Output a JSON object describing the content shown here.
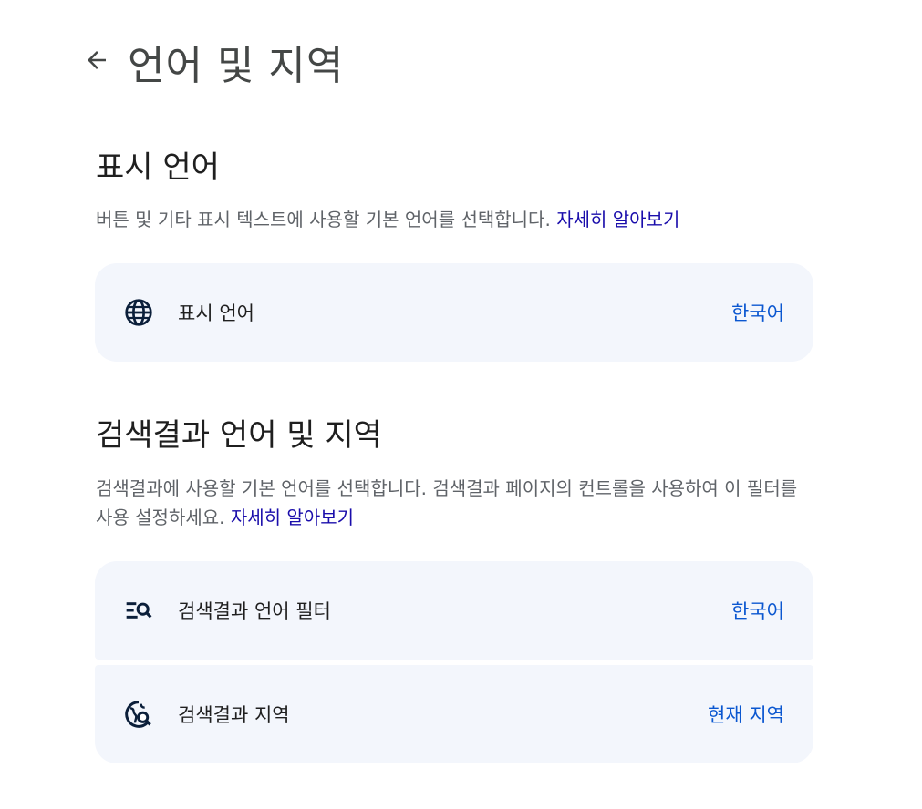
{
  "header": {
    "title": "언어 및 지역",
    "back_icon": "arrow-back-icon"
  },
  "display_language": {
    "title": "표시 언어",
    "description": "버튼 및 기타 표시 텍스트에 사용할 기본 언어를 선택합니다.",
    "learn_more": "자세히 알아보기",
    "setting": {
      "icon": "globe-icon",
      "label": "표시 언어",
      "value": "한국어"
    }
  },
  "search_results": {
    "title": "검색결과 언어 및 지역",
    "description": "검색결과에 사용할 기본 언어를 선택합니다. 검색결과 페이지의 컨트롤을 사용하여 이 필터를 사용 설정하세요.",
    "learn_more": "자세히 알아보기",
    "settings": [
      {
        "icon": "filter-search-icon",
        "label": "검색결과 언어 필터",
        "value": "한국어"
      },
      {
        "icon": "globe-search-icon",
        "label": "검색결과 지역",
        "value": "현재 지역"
      }
    ]
  },
  "colors": {
    "card_background": "#f3f6fc",
    "value_link": "#0b57d0",
    "learn_more_link": "#1a0dab",
    "icon": "#0b1f3a"
  }
}
